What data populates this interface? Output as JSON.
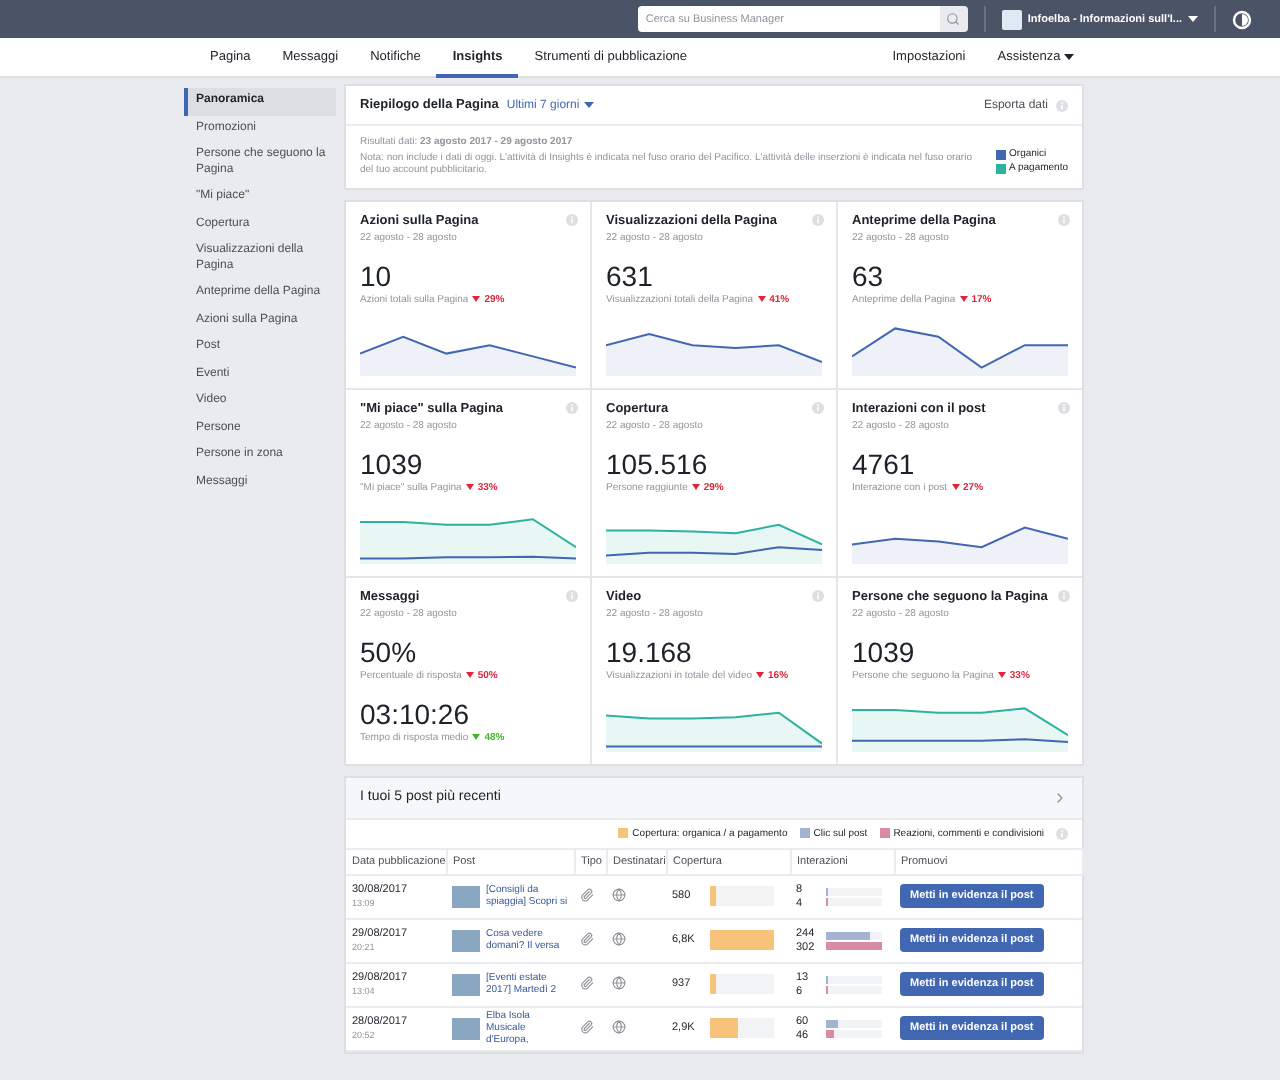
{
  "top_bar": {
    "search": {
      "placeholder": "Cerca su Business Manager"
    },
    "account": "Infoelba - Informazioni sull'I..."
  },
  "nav": {
    "tabs": [
      {
        "label": "Pagina",
        "selected": false
      },
      {
        "label": "Messaggi",
        "selected": false
      },
      {
        "label": "Notifiche",
        "selected": false
      },
      {
        "label": "Insights",
        "selected": true
      },
      {
        "label": "Strumenti di pubblicazione",
        "selected": false
      }
    ],
    "right": [
      "Impostazioni",
      "Assistenza"
    ]
  },
  "sidebar": {
    "items": [
      {
        "label": "Panoramica",
        "selected": true
      },
      {
        "label": "Promozioni",
        "selected": false
      },
      {
        "label": "Persone che seguono la Pagina",
        "selected": false
      },
      {
        "label": "\"Mi piace\"",
        "selected": false
      },
      {
        "label": "Copertura",
        "selected": false
      },
      {
        "label": "Visualizzazioni della Pagina",
        "selected": false
      },
      {
        "label": "Anteprime della Pagina",
        "selected": false
      },
      {
        "label": "Azioni sulla Pagina",
        "selected": false
      },
      {
        "label": "Post",
        "selected": false
      },
      {
        "label": "Eventi",
        "selected": false
      },
      {
        "label": "Video",
        "selected": false
      },
      {
        "label": "Persone",
        "selected": false
      },
      {
        "label": "Persone in zona",
        "selected": false
      },
      {
        "label": "Messaggi",
        "selected": false
      }
    ]
  },
  "summary": {
    "title": "Riepilogo della Pagina",
    "period": "Ultimi 7 giorni",
    "export": "Esporta dati",
    "results": "Risultati dati: **23 agosto 2017 - 29 agosto 2017**",
    "note": "Nota: non include i dati di oggi. L'attività di Insights è indicata nel fuso orario del Pacifico. L'attività delle inserzioni è indicata nel fuso orario del tuo account pubblicitario.",
    "legend": [
      {
        "label": "Organici",
        "color": "#4267b2"
      },
      {
        "label": "A pagamento",
        "color": "#2bb3a0"
      }
    ]
  },
  "cards": [
    {
      "kind": "organic",
      "title": "Azioni sulla Pagina",
      "dates": "22 agosto - 28 agosto",
      "metrics": [
        {
          "value": "10",
          "label": "Azioni totali sulla Pagina",
          "change": "29%",
          "favorable": false
        }
      ]
    },
    {
      "kind": "organic",
      "title": "Visualizzazioni della Pagina",
      "dates": "22 agosto - 28 agosto",
      "metrics": [
        {
          "value": "631",
          "label": "Visualizzazioni totali della Pagina",
          "change": "41%",
          "favorable": false
        }
      ]
    },
    {
      "kind": "organic",
      "title": "Anteprime della Pagina",
      "dates": "22 agosto - 28 agosto",
      "metrics": [
        {
          "value": "63",
          "label": "Anteprime della Pagina",
          "change": "17%",
          "favorable": false
        }
      ]
    },
    {
      "kind": "mixed",
      "title": "\"Mi piace\" sulla Pagina",
      "dates": "22 agosto - 28 agosto",
      "metrics": [
        {
          "value": "1039",
          "label": "\"Mi piace\" sulla Pagina",
          "change": "33%",
          "favorable": false
        }
      ]
    },
    {
      "kind": "mixed",
      "title": "Copertura",
      "dates": "22 agosto - 28 agosto",
      "metrics": [
        {
          "value": "105.516",
          "label": "Persone raggiunte",
          "change": "29%",
          "favorable": false
        }
      ]
    },
    {
      "kind": "organic",
      "title": "Interazioni con il post",
      "dates": "22 agosto - 28 agosto",
      "metrics": [
        {
          "value": "4761",
          "label": "Interazione con i post",
          "change": "27%",
          "favorable": false
        }
      ]
    },
    {
      "kind": "plain",
      "title": "Messaggi",
      "dates": "22 agosto - 28 agosto",
      "metrics": [
        {
          "value": "50%",
          "label": "Percentuale di risposta",
          "change": "50%",
          "favorable": false
        },
        {
          "value": "03:10:26",
          "label": "Tempo di risposta medio",
          "change": "48%",
          "favorable": true
        }
      ]
    },
    {
      "kind": "mixed",
      "title": "Video",
      "dates": "22 agosto - 28 agosto",
      "metrics": [
        {
          "value": "19.168",
          "label": "Visualizzazioni in totale del video",
          "change": "16%",
          "favorable": false
        }
      ]
    },
    {
      "kind": "mixed",
      "title": "Persone che seguono la Pagina",
      "dates": "22 agosto - 28 agosto",
      "metrics": [
        {
          "value": "1039",
          "label": "Persone che seguono la Pagina",
          "change": "33%",
          "favorable": false
        }
      ]
    }
  ],
  "posts": {
    "title": "I tuoi 5 post più recenti",
    "legend": [
      {
        "label": "Copertura: organica / a pagamento",
        "color": "#f7c27a"
      },
      {
        "label": "Clic sul post",
        "color": "#a4b3d1"
      },
      {
        "label": "Reazioni, commenti e condivisioni",
        "color": "#d88aa6"
      }
    ],
    "columns": [
      "Data pubblicazione",
      "Post",
      "Tipo",
      "Destinatari",
      "Copertura",
      "Interazioni",
      "Promuovi"
    ],
    "rows": [
      {
        "date": "30/08/2017",
        "time": "13:09",
        "text": "[Consigli da spiaggia] Scopri si",
        "coverage": {
          "value": "580",
          "level": 0.09
        },
        "clicks": {
          "value": "8",
          "level": 0.03
        },
        "reactions": {
          "value": "4",
          "level": 0.02
        },
        "button": "Metti in evidenza il post"
      },
      {
        "date": "29/08/2017",
        "time": "20:21",
        "text": "Cosa vedere domani? Il versa",
        "coverage": {
          "value": "6,8K",
          "level": 1
        },
        "clicks": {
          "value": "244",
          "level": 0.8
        },
        "reactions": {
          "value": "302",
          "level": 1
        },
        "button": "Metti in evidenza il post"
      },
      {
        "date": "29/08/2017",
        "time": "13:04",
        "text": "[Eventi estate 2017] Martedì 2",
        "coverage": {
          "value": "937",
          "level": 0.1
        },
        "clicks": {
          "value": "13",
          "level": 0.04
        },
        "reactions": {
          "value": "6",
          "level": 0.02
        },
        "button": "Metti in evidenza il post"
      },
      {
        "date": "28/08/2017",
        "time": "20:52",
        "text": "Elba Isola Musicale d'Europa,",
        "coverage": {
          "value": "2,9K",
          "level": 0.45
        },
        "clicks": {
          "value": "60",
          "level": 0.22
        },
        "reactions": {
          "value": "46",
          "level": 0.16
        },
        "button": "Metti in evidenza il post"
      }
    ]
  }
}
